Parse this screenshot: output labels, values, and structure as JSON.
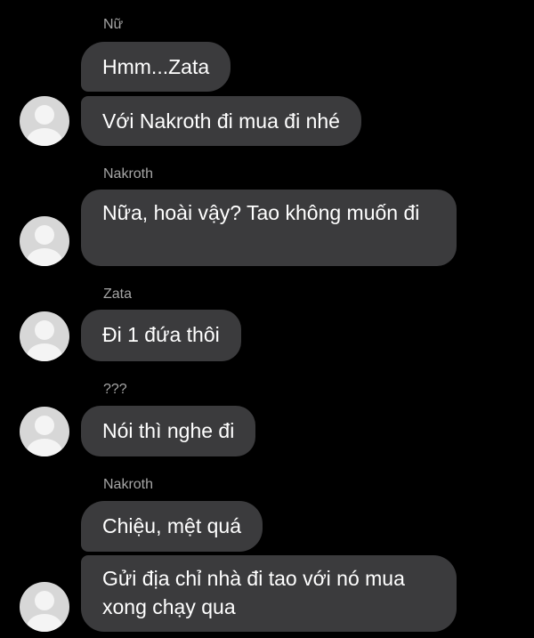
{
  "groups": [
    {
      "sender": "Nữ",
      "messages": [
        "Hmm...Zata",
        "Với Nakroth đi mua đi nhé"
      ]
    },
    {
      "sender": "Nakroth",
      "messages": [
        "Nữa, hoài vậy? Tao không muốn đi"
      ]
    },
    {
      "sender": "Zata",
      "messages": [
        "Đi 1 đứa thôi"
      ]
    },
    {
      "sender": "???",
      "messages": [
        "Nói thì nghe đi"
      ]
    },
    {
      "sender": "Nakroth",
      "messages": [
        "Chiệu, mệt quá",
        "Gửi địa chỉ nhà đi tao với nó mua xong chạy qua"
      ]
    }
  ],
  "colors": {
    "background": "#000000",
    "bubble": "#3b3b3d",
    "text": "#ffffff",
    "sender_text": "#a6a6a6",
    "avatar": "#d7d7d7"
  },
  "icons": {
    "avatar": "default-user-avatar-icon"
  }
}
